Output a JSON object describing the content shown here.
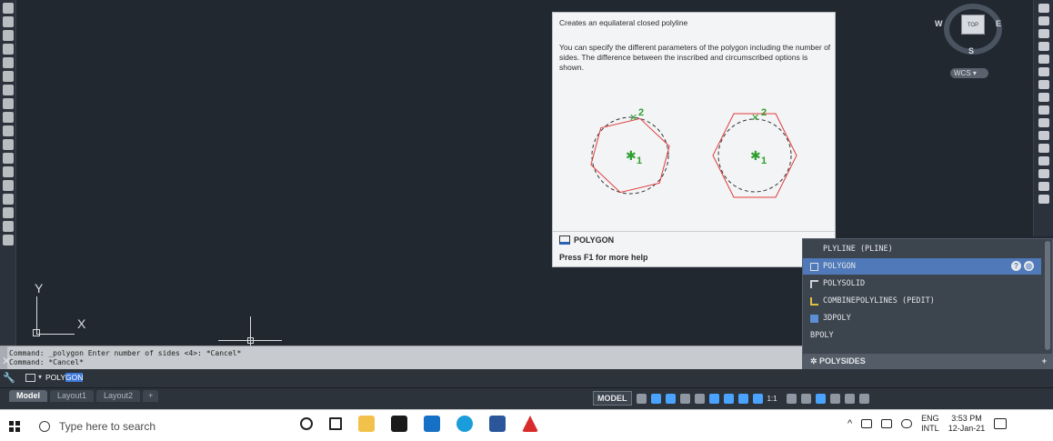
{
  "viewcube": {
    "top_label": "TOP",
    "west": "W",
    "east": "E",
    "south": "S",
    "wcs_label": "WCS"
  },
  "ucs": {
    "x_label": "X",
    "y_label": "Y"
  },
  "tooltip": {
    "title": "Creates an equilateral closed polyline",
    "description": "You can specify the different parameters of the polygon including the number of sides. The difference between the inscribed and circumscribed options is shown.",
    "figure": {
      "label_1": "1",
      "label_2": "2"
    },
    "command": "POLYGON",
    "help": "Press F1 for more help"
  },
  "autocomplete": {
    "items": [
      {
        "label": "PLYLINE (PLINE)",
        "icon": "pline-icon"
      },
      {
        "label": "POLYGON",
        "icon": "polygon-icon",
        "selected": true
      },
      {
        "label": "POLYSOLID",
        "icon": "polysolid-icon"
      },
      {
        "label": "COMBINEPOLYLINES (PEDIT)",
        "icon": "pedit-icon"
      },
      {
        "label": "3DPOLY",
        "icon": "3dpoly-icon"
      },
      {
        "label": "BPOLY",
        "icon": ""
      }
    ],
    "footer": "POLYSIDES",
    "help_q": "?",
    "help_globe": "◎"
  },
  "command_history": {
    "line1": "Command: _polygon Enter number of sides <4>: *Cancel*",
    "line2": "Command: *Cancel*"
  },
  "command_line": {
    "typed_prefix": "POLY",
    "typed_highlight": "GON"
  },
  "layout_tabs": [
    "Model",
    "Layout1",
    "Layout2",
    "+"
  ],
  "status": {
    "model_label": "MODEL",
    "scale": "1:1"
  },
  "taskbar": {
    "search_placeholder": "Type here to search",
    "lang_top": "ENG",
    "lang_bottom": "INTL",
    "time": "3:53 PM",
    "date": "12-Jan-21"
  }
}
